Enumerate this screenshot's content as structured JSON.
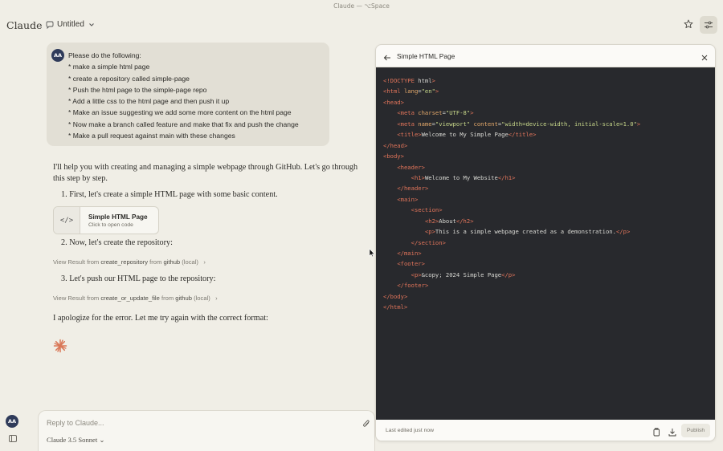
{
  "window": {
    "title": "Claude — ⌥Space"
  },
  "header": {
    "brand": "Claude",
    "chat_title": "Untitled"
  },
  "user": {
    "initials": "AA",
    "message_lines": [
      "Please do the following:",
      "* make a simple html page",
      "* create a repository called simple-page",
      "* Push the html page to the simple-page repo",
      "* Add a little css to the html page and then push it up",
      "* Make an issue suggesting we add some more content on the html page",
      "* Now make a branch called feature and make that fix and push the change",
      "* Make a pull request against main with these changes"
    ]
  },
  "assistant": {
    "intro": "I'll help you with creating and managing a simple webpage through GitHub. Let's go through this step by step.",
    "step1": "1. First, let's create a simple HTML page with some basic content.",
    "artifact_card": {
      "title": "Simple HTML Page",
      "subtitle": "Click to open code",
      "icon": "</>"
    },
    "step2": "2. Now, let's create the repository:",
    "tool1": {
      "prefix": "View Result from ",
      "tool": "create_repository",
      "mid": " from ",
      "server": "github",
      "suffix": " (local)"
    },
    "step3": "3. Let's push our HTML page to the repository:",
    "tool2": {
      "prefix": "View Result from ",
      "tool": "create_or_update_file",
      "mid": " from ",
      "server": "github",
      "suffix": " (local)"
    },
    "apology": "I apologize for the error. Let me try again with the correct format:"
  },
  "composer": {
    "placeholder": "Reply to Claude...",
    "model": "Claude 3.5 Sonnet"
  },
  "artifact_panel": {
    "title": "Simple HTML Page",
    "last_edited": "Last edited just now",
    "publish_label": "Publish",
    "code_lines": [
      "<!DOCTYPE html>",
      "<html lang=\"en\">",
      "<head>",
      "    <meta charset=\"UTF-8\">",
      "    <meta name=\"viewport\" content=\"width=device-width, initial-scale=1.0\">",
      "    <title>Welcome to My Simple Page</title>",
      "</head>",
      "<body>",
      "    <header>",
      "        <h1>Welcome to My Website</h1>",
      "    </header>",
      "    <main>",
      "        <section>",
      "            <h2>About</h2>",
      "            <p>This is a simple webpage created as a demonstration.</p>",
      "        </section>",
      "    </main>",
      "    <footer>",
      "        <p>&copy; 2024 Simple Page</p>",
      "    </footer>",
      "</body>",
      "</html>"
    ]
  },
  "colors": {
    "background": "#f0eee6",
    "code_bg": "#28292d",
    "tag": "#e0745a",
    "attr": "#e3a86a",
    "string": "#c8d88a",
    "avatar": "#2f3b5a",
    "spark": "#d97757"
  }
}
